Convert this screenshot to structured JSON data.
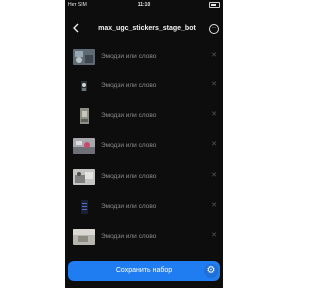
{
  "status_bar": {
    "carrier": "Нет SIM",
    "time": "11:10"
  },
  "header": {
    "title": "max_ugc_stickers_stage_bot",
    "back_icon": "chevron-left-icon",
    "more_icon": "more-circle-icon"
  },
  "stickers": [
    {
      "label": "Эмодзи или слово"
    },
    {
      "label": "Эмодзи или слово"
    },
    {
      "label": "Эмодзи или слово"
    },
    {
      "label": "Эмодзи или слово"
    },
    {
      "label": "Эмодзи или слово"
    },
    {
      "label": "Эмодзи или слово"
    },
    {
      "label": "Эмодзи или слово"
    }
  ],
  "save_button": {
    "label": "Сохранить набор",
    "color": "#1f7cf1"
  },
  "settings_icon": "gear-icon"
}
